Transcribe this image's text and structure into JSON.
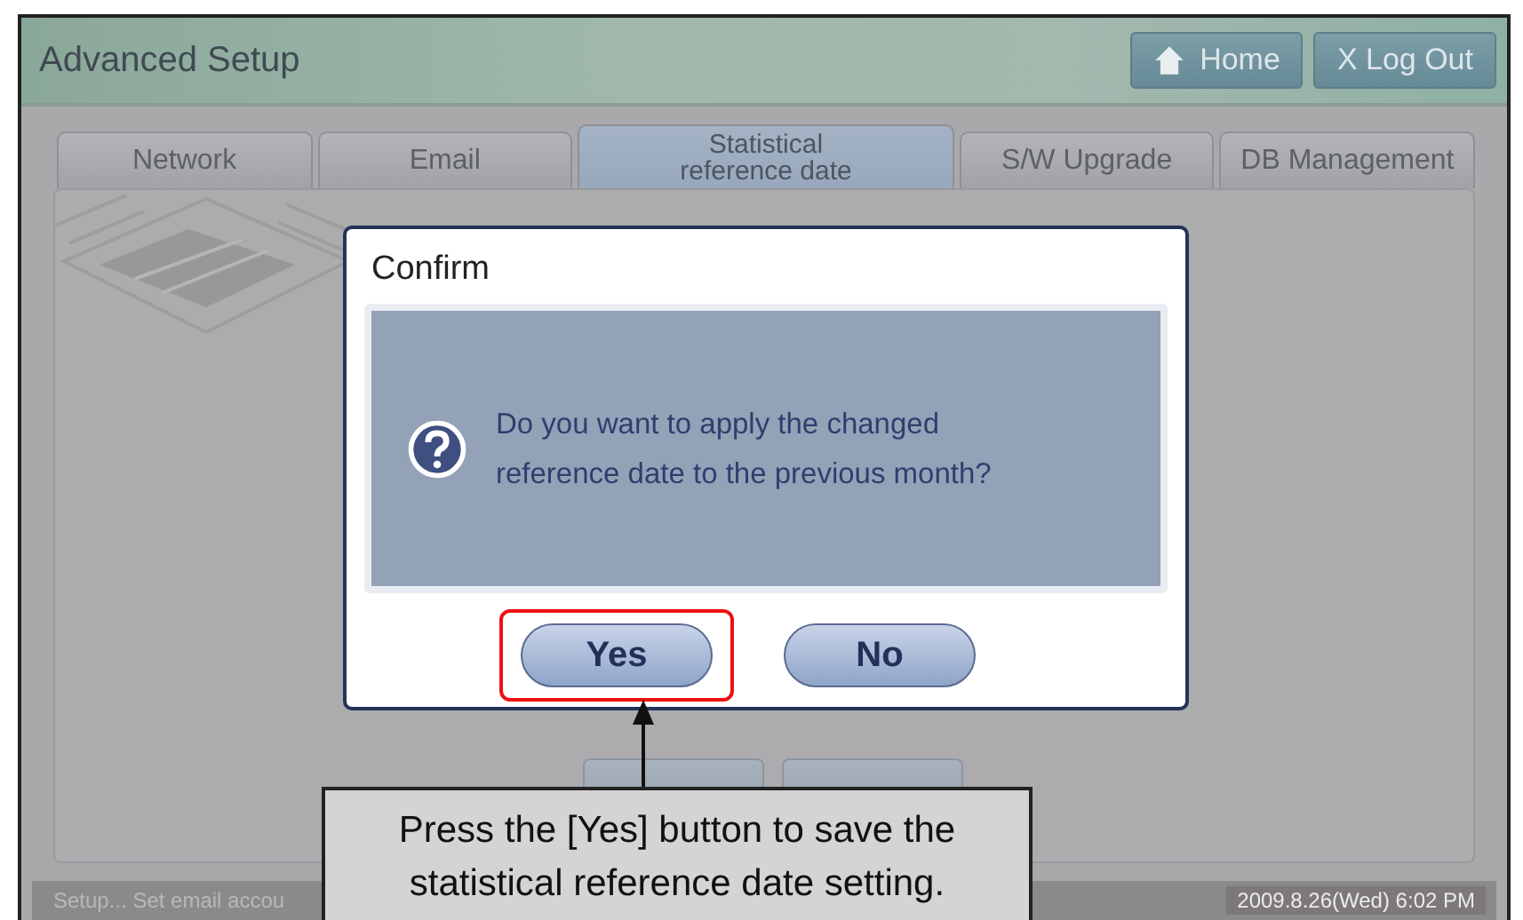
{
  "app": {
    "title": "Advanced Setup",
    "buttons": [
      {
        "kind": "home",
        "label": "Home"
      },
      {
        "kind": "logout",
        "label": "X Log Out"
      }
    ]
  },
  "tabs": [
    {
      "label": "Network",
      "selected": false
    },
    {
      "label": "Email",
      "selected": false
    },
    {
      "label": "Statistical reference date",
      "selected": true
    },
    {
      "label": "S/W Upgrade",
      "selected": false
    },
    {
      "label": "DB Management",
      "selected": false
    }
  ],
  "status_bar": {
    "message": "Setup... Set email accou",
    "datetime": "2009.8.26(Wed)  6:02 PM"
  },
  "dialog": {
    "title": "Confirm",
    "message": "Do you want to apply the changed reference date to the previous month?",
    "buttons": [
      {
        "label": "Yes",
        "highlighted": true
      },
      {
        "label": "No",
        "highlighted": false
      }
    ]
  },
  "callout": {
    "text": "Press the [Yes] button to save the statistical reference date setting."
  }
}
